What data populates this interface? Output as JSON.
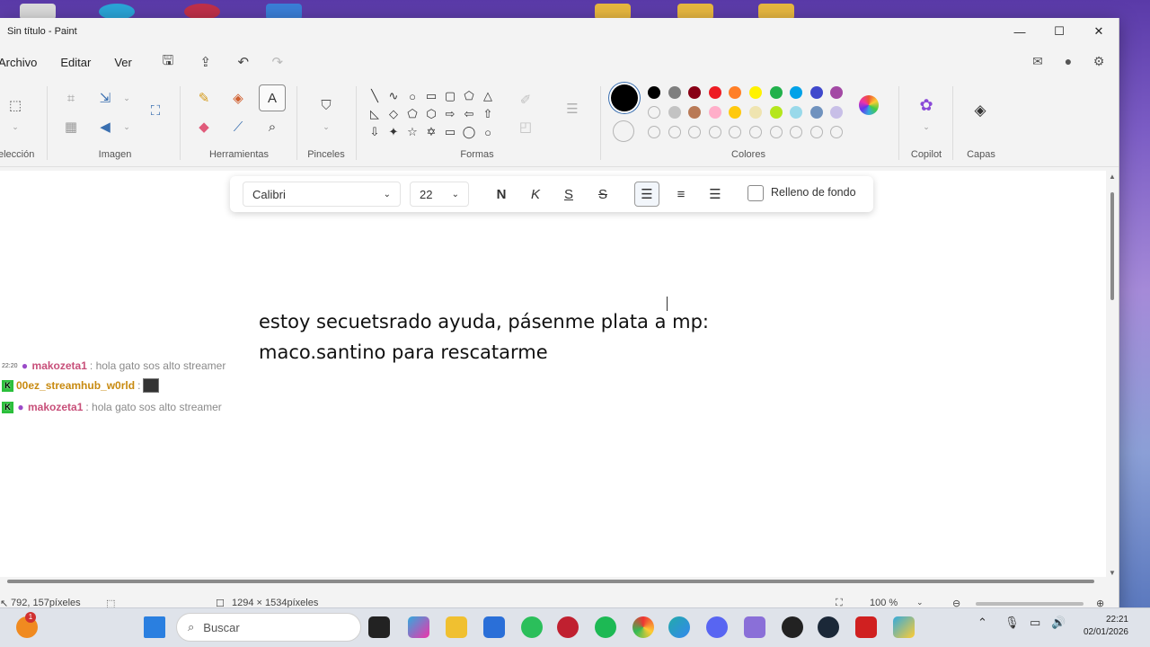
{
  "window": {
    "title": "Sin título - Paint"
  },
  "menu": {
    "items": [
      "Archivo",
      "Editar",
      "Ver"
    ]
  },
  "ribbon": {
    "groups": {
      "seleccion": "elección",
      "imagen": "Imagen",
      "herramientas": "Herramientas",
      "pinceles": "Pinceles",
      "formas": "Formas",
      "colores": "Colores",
      "copilot": "Copilot",
      "capas": "Capas"
    },
    "colors": {
      "primary": "#000000",
      "row1": [
        "#000000",
        "#7f7f7f",
        "#880015",
        "#ed1c24",
        "#ff7f27",
        "#fff200",
        "#22b14c",
        "#00a2e8",
        "#3f48cc",
        "#a349a4"
      ],
      "row2": [
        "",
        "#c3c3c3",
        "#b97a57",
        "#ffaec9",
        "#ffc90e",
        "#efe4b0",
        "#b5e61d",
        "#99d9ea",
        "#7092be",
        "#c8bfe7"
      ]
    }
  },
  "textbar": {
    "font": "Calibri",
    "size": "22",
    "bold": "N",
    "italic": "K",
    "underline": "S",
    "strike": "S",
    "fill_label": "Relleno de fondo"
  },
  "canvas": {
    "line1": "estoy secuetsrado ayuda, pásenme plata a mp:",
    "line2": "maco.santino para rescatarme"
  },
  "chat": [
    {
      "time": "22:20",
      "user": "makozeta1",
      "message": ": hola gato sos alto streamer"
    },
    {
      "badge": "K",
      "user": "00ez_streamhub_w0rld",
      "message": ":"
    },
    {
      "badge": "K",
      "user": "makozeta1",
      "message": ": hola gato sos alto streamer"
    }
  ],
  "status": {
    "position": "792, 157píxeles",
    "size": "1294 × 1534píxeles",
    "zoom": "100 %"
  },
  "taskbar": {
    "search_placeholder": "Buscar",
    "badge_count": "1",
    "time": "22:21",
    "date": "02/01/2026"
  }
}
